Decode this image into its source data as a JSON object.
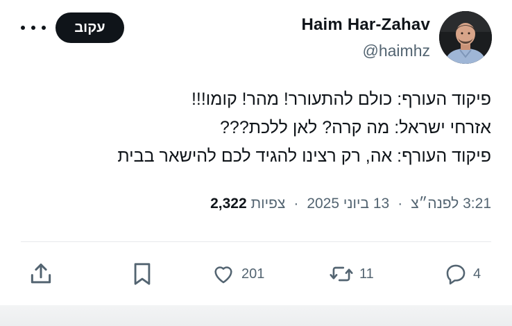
{
  "author": {
    "name": "Haim Har-Zahav",
    "handle": "@haimhz"
  },
  "follow_label": "עקוב",
  "tweet": {
    "lines": [
      "פיקוד העורף: כולם להתעורר! מהר! קומו!!!",
      "אזרחי ישראל: מה קרה? לאן ללכת???",
      "פיקוד העורף: אה, רק רצינו להגיד לכם להישאר בבית"
    ]
  },
  "meta": {
    "time": "3:21 לפנה״צ",
    "date": "13 ביוני 2025",
    "views_label": "צפיות",
    "views_count": "2,322",
    "separator": "·"
  },
  "actions": {
    "replies": "4",
    "retweets": "11",
    "likes": "201"
  },
  "icons": {
    "more": "more-horizontal-icon",
    "reply": "reply-icon",
    "retweet": "retweet-icon",
    "like": "heart-icon",
    "bookmark": "bookmark-icon",
    "share": "share-icon"
  },
  "colors": {
    "text": "#0f1419",
    "muted": "#536471",
    "follow_bg": "#0f1419",
    "divider": "#e6e9eb"
  }
}
